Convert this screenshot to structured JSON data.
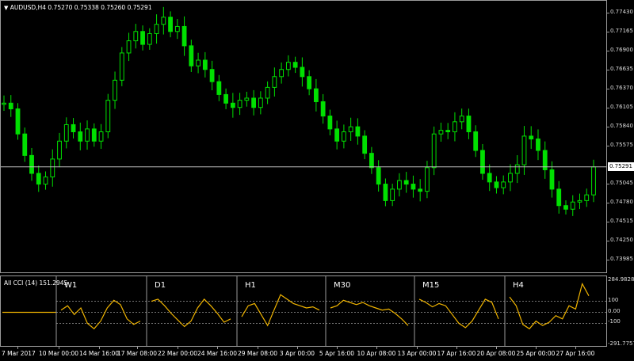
{
  "header": {
    "triangle": "▼",
    "symbol": "AUDUSD,H4",
    "ohlc": "0.75270 0.75338 0.75260 0.75291"
  },
  "price_axis": [
    "0.77430",
    "0.77165",
    "0.76900",
    "0.76635",
    "0.76370",
    "0.76105",
    "0.75840",
    "0.75575",
    "0.75045",
    "0.74780",
    "0.74515",
    "0.74250",
    "0.73985"
  ],
  "current_price": "0.75291",
  "indicator": {
    "title": "All CCI (14) 151.2945",
    "high_label": "284.9828",
    "low_label": "-291.7757",
    "levels": [
      "100",
      "0.00",
      "-100"
    ],
    "panels": [
      "W1",
      "D1",
      "H1",
      "M30",
      "M15",
      "H4"
    ]
  },
  "time_axis": [
    "7 Mar 2017",
    "10 Mar 00:00",
    "14 Mar 16:00",
    "17 Mar 08:00",
    "22 Mar 00:00",
    "24 Mar 16:00",
    "29 Mar 08:00",
    "3 Apr 00:00",
    "5 Apr 16:00",
    "10 Apr 08:00",
    "13 Apr 00:00",
    "17 Apr 16:00",
    "20 Apr 08:00",
    "25 Apr 00:00",
    "27 Apr 16:00"
  ],
  "colors": {
    "background": "#000000",
    "candle": "#00e000",
    "cci_line": "#f0b400",
    "grid": "#9a9a9a",
    "text": "#ffffff"
  },
  "chart_data": {
    "type": "line",
    "title": "AUDUSD,H4",
    "close": [
      0.7618,
      0.761,
      0.7575,
      0.7545,
      0.752,
      0.7505,
      0.7515,
      0.754,
      0.7565,
      0.7588,
      0.7578,
      0.7565,
      0.7582,
      0.7565,
      0.7578,
      0.7622,
      0.765,
      0.7688,
      0.7705,
      0.7718,
      0.77,
      0.7715,
      0.7728,
      0.7738,
      0.7718,
      0.7725,
      0.7698,
      0.767,
      0.7678,
      0.7665,
      0.7648,
      0.763,
      0.7618,
      0.7612,
      0.7622,
      0.7625,
      0.7612,
      0.7625,
      0.764,
      0.7655,
      0.7665,
      0.7675,
      0.7668,
      0.7655,
      0.7638,
      0.762,
      0.76,
      0.7582,
      0.7565,
      0.7578,
      0.7585,
      0.7572,
      0.7548,
      0.7528,
      0.7505,
      0.7482,
      0.7498,
      0.751,
      0.7505,
      0.7498,
      0.7495,
      0.7528,
      0.7575,
      0.758,
      0.7578,
      0.7592,
      0.76,
      0.7578,
      0.7552,
      0.752,
      0.7508,
      0.75,
      0.7508,
      0.752,
      0.7532,
      0.7572,
      0.7568,
      0.7552,
      0.7525,
      0.7498,
      0.7475,
      0.747,
      0.748,
      0.7482,
      0.749,
      0.7529
    ],
    "ylim": [
      0.7383,
      0.7752
    ],
    "cci_series": [
      {
        "name": "W1",
        "values": [
          20,
          60,
          -20,
          40,
          -100,
          -150,
          -80,
          40,
          110,
          70,
          -60,
          -110,
          -80
        ]
      },
      {
        "name": "D1",
        "values": [
          100,
          120,
          60,
          -10,
          -70,
          -130,
          -80,
          40,
          120,
          60,
          -10,
          -90,
          -60
        ]
      },
      {
        "name": "H1",
        "values": [
          -40,
          60,
          80,
          -20,
          -120,
          20,
          160,
          120,
          80,
          60,
          40,
          50,
          20
        ]
      },
      {
        "name": "M30",
        "values": [
          40,
          60,
          110,
          90,
          70,
          90,
          60,
          40,
          20,
          30,
          -10,
          -60,
          -120
        ]
      },
      {
        "name": "M15",
        "values": [
          120,
          90,
          50,
          80,
          60,
          -20,
          -100,
          -140,
          -80,
          20,
          120,
          90,
          -60
        ]
      },
      {
        "name": "H4",
        "values": [
          140,
          60,
          -110,
          -150,
          -80,
          -120,
          -90,
          -30,
          -60,
          60,
          30,
          260,
          150
        ]
      }
    ]
  }
}
